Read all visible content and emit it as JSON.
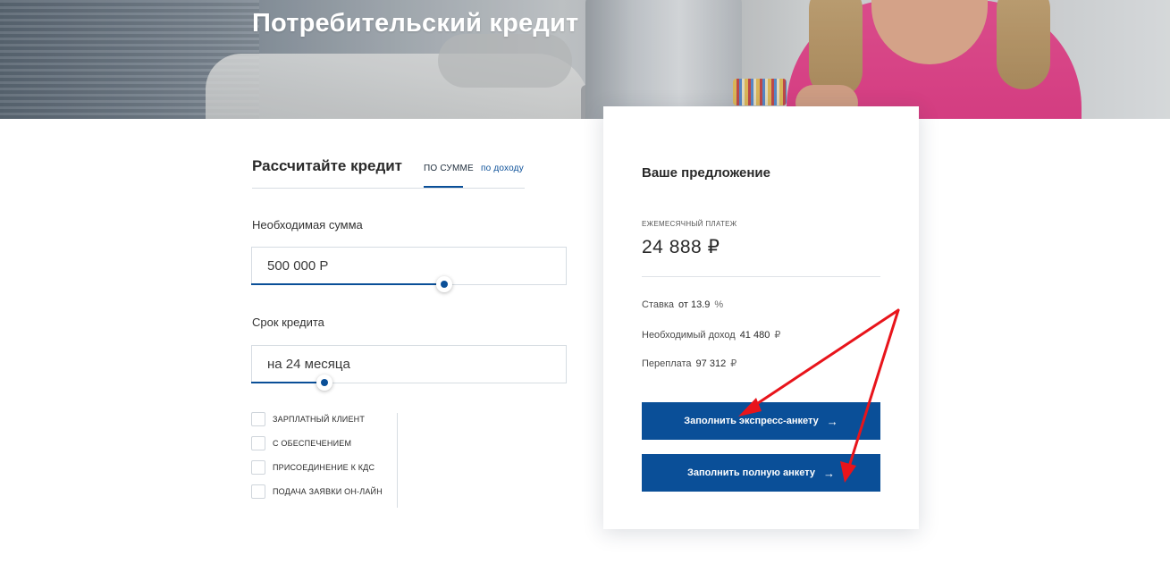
{
  "hero": {
    "title": "Потребительский кредит"
  },
  "calculator": {
    "title": "Рассчитайте кредит",
    "tabs": [
      {
        "label": "ПО СУММЕ",
        "active": true
      },
      {
        "label": "по доходу",
        "active": false
      }
    ],
    "amount": {
      "label": "Необходимая сумма",
      "value": "500 000 Р"
    },
    "term": {
      "label": "Срок кредита",
      "value": "на 24 месяца"
    },
    "options": [
      {
        "label": "ЗАРПЛАТНЫЙ КЛИЕНТ",
        "checked": false
      },
      {
        "label": "С ОБЕСПЕЧЕНИЕМ",
        "checked": false
      },
      {
        "label": "ПРИСОЕДИНЕНИЕ К КДС",
        "checked": false
      },
      {
        "label": "ПОДАЧА ЗАЯВКИ ОН-ЛАЙН",
        "checked": false
      }
    ]
  },
  "offer": {
    "title": "Ваше предложение",
    "payment_label": "ЕЖЕМЕСЯЧНЫЙ ПЛАТЕЖ",
    "payment_value": "24 888 ₽",
    "rate": {
      "label": "Ставка",
      "value": "от 13.9",
      "unit": "%"
    },
    "income": {
      "label": "Необходимый доход",
      "value": "41 480",
      "unit": "₽"
    },
    "overpay": {
      "label": "Переплата",
      "value": "97 312",
      "unit": "₽"
    },
    "buttons": {
      "express": "Заполнить экспресс-анкету",
      "full": "Заполнить полную анкету",
      "arrow": "→"
    }
  },
  "colors": {
    "accent": "#0a4f98",
    "annotation": "#e8141b"
  }
}
